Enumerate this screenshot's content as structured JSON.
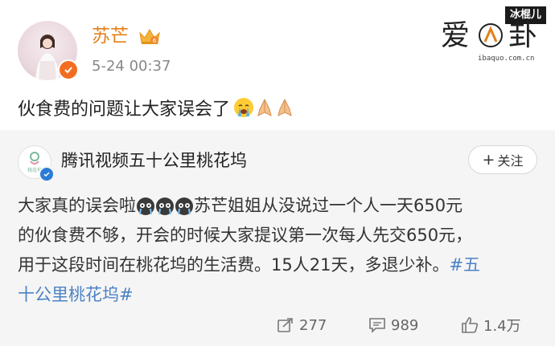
{
  "watermark": {
    "tag": "冰棍儿",
    "logo_text": "爱八卦",
    "url": "ibaquo.com.cn"
  },
  "post": {
    "username": "苏芒",
    "time": "5-24 00:37",
    "text": "伙食费的问题让大家误会了",
    "emoji": [
      "crying-face",
      "folded-hands",
      "folded-hands"
    ]
  },
  "retweet": {
    "source_name": "腾讯视频五十公里桃花坞",
    "follow_label": "关注",
    "line1_a": "大家真的误会啦",
    "line1_b": "苏芒姐姐从没说过一个人一天650元",
    "line2": "的伙食费不够，开会的时候大家提议第一次每人先交650元，",
    "line3_a": "用于这段时间在桃花坞的生活费。15人21天，多退少补。",
    "line3_tag": "#五",
    "line4_tag": "十公里桃花坞#",
    "emoji": [
      "dizzy-crying-face",
      "dizzy-crying-face",
      "dizzy-crying-face"
    ]
  },
  "actions": {
    "reposts": "277",
    "comments": "989",
    "likes": "1.4万"
  },
  "colors": {
    "username": "#e3811a",
    "hashtag": "#4b82c4",
    "card_bg": "#f5f5f5",
    "verified_orange": "#f36d21",
    "verified_blue": "#2b7cd6"
  }
}
